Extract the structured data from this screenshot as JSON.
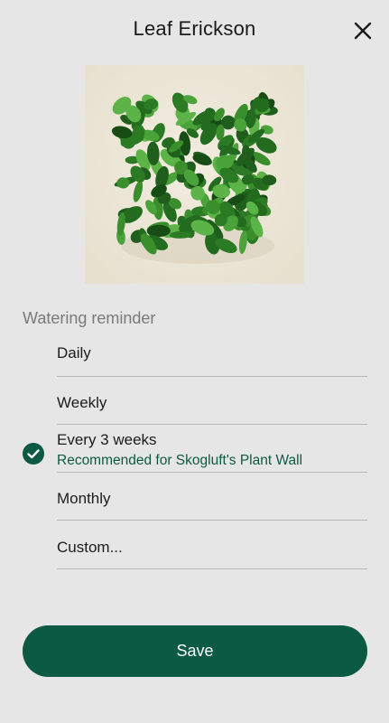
{
  "header": {
    "title": "Leaf Erickson",
    "close_icon": "close-icon"
  },
  "plant": {
    "image": "plant-wall-photo",
    "background_color": "#eee9db"
  },
  "reminder": {
    "section_label": "Watering reminder",
    "options": [
      {
        "label": "Daily",
        "selected": false
      },
      {
        "label": "Weekly",
        "selected": false
      },
      {
        "label": "Every 3 weeks",
        "subtitle": "Recommended for Skogluft's Plant Wall",
        "selected": true
      },
      {
        "label": "Monthly",
        "selected": false
      },
      {
        "label": "Custom...",
        "selected": false
      }
    ],
    "selected_icon": "check-circle-icon"
  },
  "footer": {
    "save_label": "Save"
  },
  "colors": {
    "accent": "#0c5a42",
    "background": "#e6e6e6",
    "section_label": "#7a7a7a",
    "divider": "#b7b7b7"
  }
}
